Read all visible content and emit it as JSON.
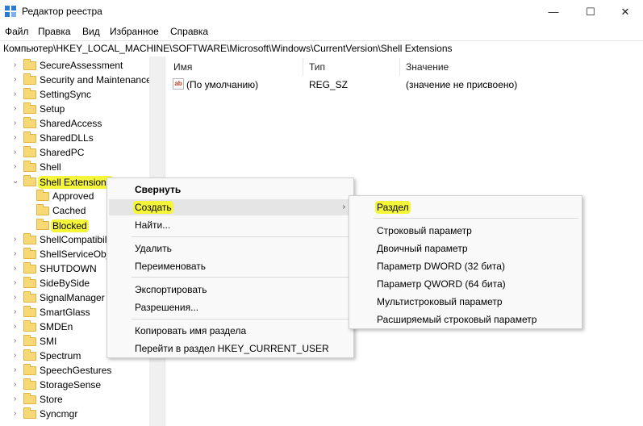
{
  "window": {
    "title": "Редактор реестра",
    "minimize": "—",
    "maximize": "☐",
    "close": "✕"
  },
  "menu": [
    "Файл",
    "Правка",
    "Вид",
    "Избранное",
    "Справка"
  ],
  "address": "Компьютер\\HKEY_LOCAL_MACHINE\\SOFTWARE\\Microsoft\\Windows\\CurrentVersion\\Shell Extensions",
  "tree": {
    "items": [
      {
        "label": "SecureAssessment"
      },
      {
        "label": "Security and Maintenance"
      },
      {
        "label": "SettingSync"
      },
      {
        "label": "Setup"
      },
      {
        "label": "SharedAccess"
      },
      {
        "label": "SharedDLLs"
      },
      {
        "label": "SharedPC"
      },
      {
        "label": "Shell"
      },
      {
        "label": "Shell Extensions"
      },
      {
        "label": "Approved"
      },
      {
        "label": "Cached"
      },
      {
        "label": "Blocked"
      },
      {
        "label": "ShellCompatibil"
      },
      {
        "label": "ShellServiceObje"
      },
      {
        "label": "SHUTDOWN"
      },
      {
        "label": "SideBySide"
      },
      {
        "label": "SignalManager"
      },
      {
        "label": "SmartGlass"
      },
      {
        "label": "SMDEn"
      },
      {
        "label": "SMI"
      },
      {
        "label": "Spectrum"
      },
      {
        "label": "SpeechGestures"
      },
      {
        "label": "StorageSense"
      },
      {
        "label": "Store"
      },
      {
        "label": "Syncmgr"
      }
    ]
  },
  "list": {
    "headers": {
      "name": "Имя",
      "type": "Тип",
      "value": "Значение"
    },
    "rows": [
      {
        "icon": "ab",
        "name": "(По умолчанию)",
        "type": "REG_SZ",
        "value": "(значение не присвоено)"
      }
    ]
  },
  "context_menu": {
    "collapse": "Свернуть",
    "create": "Создать",
    "find": "Найти...",
    "delete": "Удалить",
    "rename": "Переименовать",
    "export": "Экспортировать",
    "permissions": "Разрешения...",
    "copy_name": "Копировать имя раздела",
    "goto": "Перейти в раздел HKEY_CURRENT_USER"
  },
  "submenu": {
    "key": "Раздел",
    "string": "Строковый параметр",
    "binary": "Двоичный параметр",
    "dword": "Параметр DWORD (32 бита)",
    "qword": "Параметр QWORD (64 бита)",
    "multi": "Мультистроковый параметр",
    "expand": "Расширяемый строковый параметр"
  },
  "colors": {
    "highlight": "#f5f53a",
    "folder": "#f8d775"
  }
}
